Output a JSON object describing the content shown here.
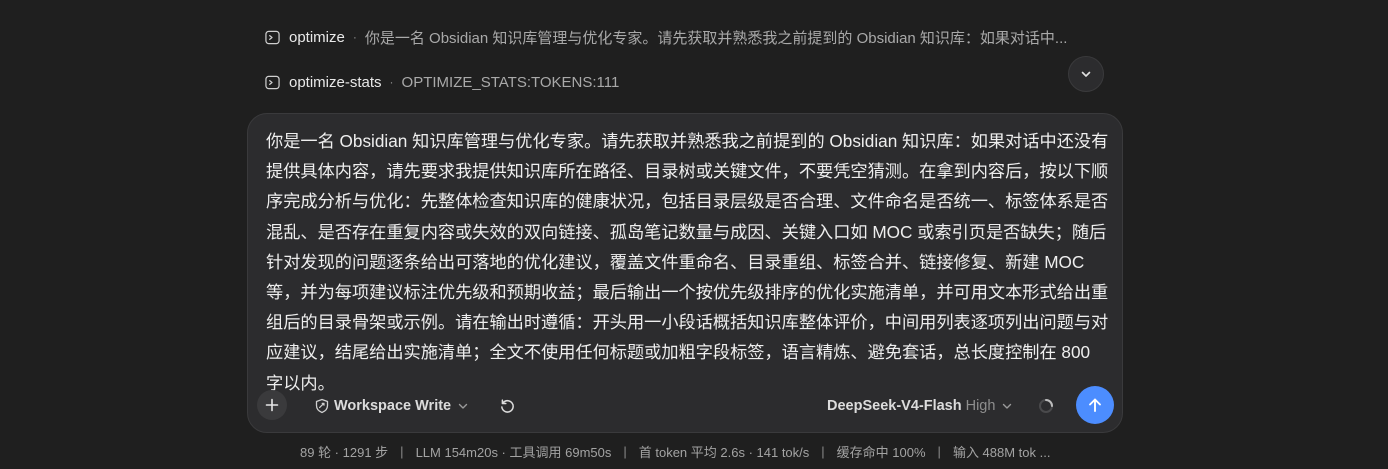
{
  "suggestions": [
    {
      "icon": "terminal-icon",
      "name": "optimize",
      "separator": "·",
      "description": "你是一名 Obsidian 知识库管理与优化专家。请先获取并熟悉我之前提到的 Obsidian 知识库：如果对话中..."
    },
    {
      "icon": "terminal-icon",
      "name": "optimize-stats",
      "separator": "·",
      "description": "OPTIMIZE_STATS:TOKENS:111"
    }
  ],
  "collapse_icon": "chevron-down-icon",
  "composer": {
    "prompt": "你是一名 Obsidian 知识库管理与优化专家。请先获取并熟悉我之前提到的 Obsidian 知识库：如果对话中还没有提供具体内容，请先要求我提供知识库所在路径、目录树或关键文件，不要凭空猜测。在拿到内容后，按以下顺序完成分析与优化：先整体检查知识库的健康状况，包括目录层级是否合理、文件命名是否统一、标签体系是否混乱、是否存在重复内容或失效的双向链接、孤岛笔记数量与成因、关键入口如 MOC 或索引页是否缺失；随后针对发现的问题逐条给出可落地的优化建议，覆盖文件重命名、目录重组、标签合并、链接修复、新建 MOC 等，并为每项建议标注优先级和预期收益；最后输出一个按优先级排序的优化实施清单，并可用文本形式给出重组后的目录骨架或示例。请在输出时遵循：开头用一小段话概括知识库整体评价，中间用列表逐项列出问题与对应建议，结尾给出实施清单；全文不使用任何标题或加粗字段标签，语言精炼、避免套话，总长度控制在 800 字以内。",
    "toolbar": {
      "add_icon": "plus-icon",
      "workspace_icon": "shield-icon",
      "workspace_label": "Workspace Write",
      "workspace_chevron": "chevron-down-icon",
      "undo_icon": "undo-icon",
      "model_name": "DeepSeek-V4-Flash",
      "model_level": "High",
      "model_chevron": "chevron-down-icon",
      "spinner_icon": "loading-spinner-icon",
      "send_icon": "arrow-up-icon"
    }
  },
  "status": {
    "items": [
      "89 轮 · 1291 步",
      "LLM 154m20s · 工具调用 69m50s",
      "首 token 平均 2.6s · 141 tok/s",
      "缓存命中 100%",
      "输入 488M tok ..."
    ],
    "separator": "|"
  },
  "colors": {
    "background": "#1f1f1f",
    "composer_bg": "#2c2c2e",
    "accent": "#4c8dff",
    "muted_text": "#a3a3a3"
  }
}
